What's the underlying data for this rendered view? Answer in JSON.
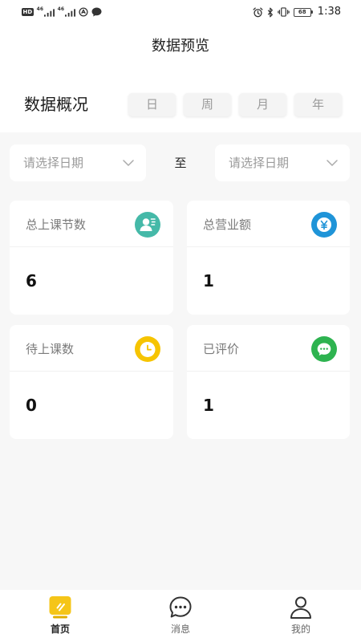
{
  "status_bar": {
    "hd_label": "HD",
    "signal_1_label": "46",
    "signal_2_label": "46",
    "battery_level": "68",
    "time": "1:38",
    "left_icons": [
      "signal-icon",
      "signal-icon",
      "app-notification-icon",
      "chat-notification-icon"
    ],
    "right_icons": [
      "alarm-icon",
      "bluetooth-icon",
      "vibrate-icon",
      "battery-icon"
    ]
  },
  "header": {
    "title": "数据预览"
  },
  "overview": {
    "title": "数据概况",
    "periods": [
      {
        "label": "日"
      },
      {
        "label": "周"
      },
      {
        "label": "月"
      },
      {
        "label": "年"
      }
    ]
  },
  "date_range": {
    "start_placeholder": "请选择日期",
    "separator": "至",
    "end_placeholder": "请选择日期",
    "picker_icon": "chevron-down-icon"
  },
  "stats": [
    {
      "label": "总上课节数",
      "value": 6,
      "icon": "class-count-icon",
      "color": "#45b9a8"
    },
    {
      "label": "总营业额",
      "value": 1,
      "icon": "revenue-yen-icon",
      "color": "#1f94d8"
    },
    {
      "label": "待上课数",
      "value": 0,
      "icon": "pending-clock-icon",
      "color": "#f6c400"
    },
    {
      "label": "已评价",
      "value": 1,
      "icon": "reviewed-chat-icon",
      "color": "#2eb350"
    }
  ],
  "tab_bar": {
    "active_color": "#f5c518",
    "items": [
      {
        "label": "首页",
        "icon": "home-icon",
        "active": true
      },
      {
        "label": "消息",
        "icon": "message-icon",
        "active": false
      },
      {
        "label": "我的",
        "icon": "profile-icon",
        "active": false
      }
    ]
  },
  "colors": {
    "page_background": "#ffffff",
    "content_background": "#f7f7f7",
    "placeholder_text": "#9a9a9a"
  }
}
